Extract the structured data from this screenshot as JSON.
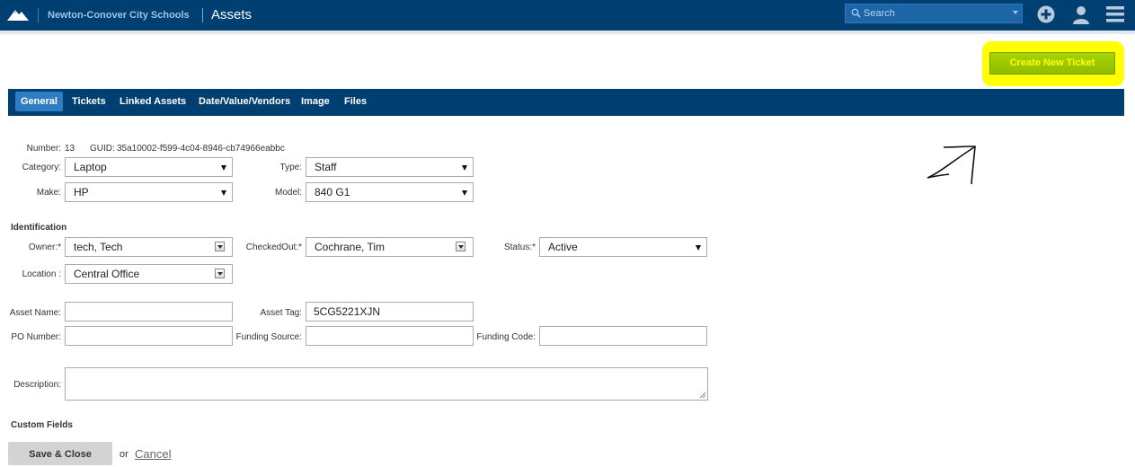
{
  "header": {
    "org": "Newton-Conover City Schools",
    "app": "Assets",
    "search_placeholder": "Search"
  },
  "actions": {
    "create_ticket": "Create New Ticket"
  },
  "tabs": [
    {
      "label": "General",
      "active": true
    },
    {
      "label": "Tickets",
      "active": false
    },
    {
      "label": "Linked Assets",
      "active": false
    },
    {
      "label": "Date/Value/Vendors",
      "active": false
    },
    {
      "label": "Image",
      "active": false
    },
    {
      "label": "Files",
      "active": false
    }
  ],
  "general": {
    "number_label": "Number:",
    "number": "13",
    "guid_label": "GUID:",
    "guid": "35a10002-f599-4c04-8946-cb74966eabbc",
    "category_label": "Category:",
    "category": "Laptop",
    "type_label": "Type:",
    "type": "Staff",
    "make_label": "Make:",
    "make": "HP",
    "model_label": "Model:",
    "model": "840 G1"
  },
  "identification": {
    "heading": "Identification",
    "owner_label": "Owner:*",
    "owner": "tech, Tech",
    "checkedout_label": "CheckedOut:*",
    "checkedout": "Cochrane, Tim",
    "status_label": "Status:*",
    "status": "Active",
    "location_label": "Location :",
    "location": "Central Office"
  },
  "details": {
    "asset_name_label": "Asset Name:",
    "asset_name": "",
    "asset_tag_label": "Asset Tag:",
    "asset_tag": "5CG5221XJN",
    "po_label": "PO Number:",
    "po": "",
    "funding_source_label": "Funding Source:",
    "funding_source": "",
    "funding_code_label": "Funding Code:",
    "funding_code": "",
    "description_label": "Description:"
  },
  "custom_fields": {
    "heading": "Custom Fields"
  },
  "footer": {
    "save": "Save & Close",
    "or": "or",
    "cancel": "Cancel"
  },
  "colors": {
    "header": "#003f72",
    "accent": "#2f7cc4",
    "create_button": "#99c800",
    "highlight": "#ffff00"
  },
  "icons": [
    "mountain-logo-icon",
    "search-icon",
    "add-circle-icon",
    "user-icon",
    "hamburger-menu-icon"
  ]
}
